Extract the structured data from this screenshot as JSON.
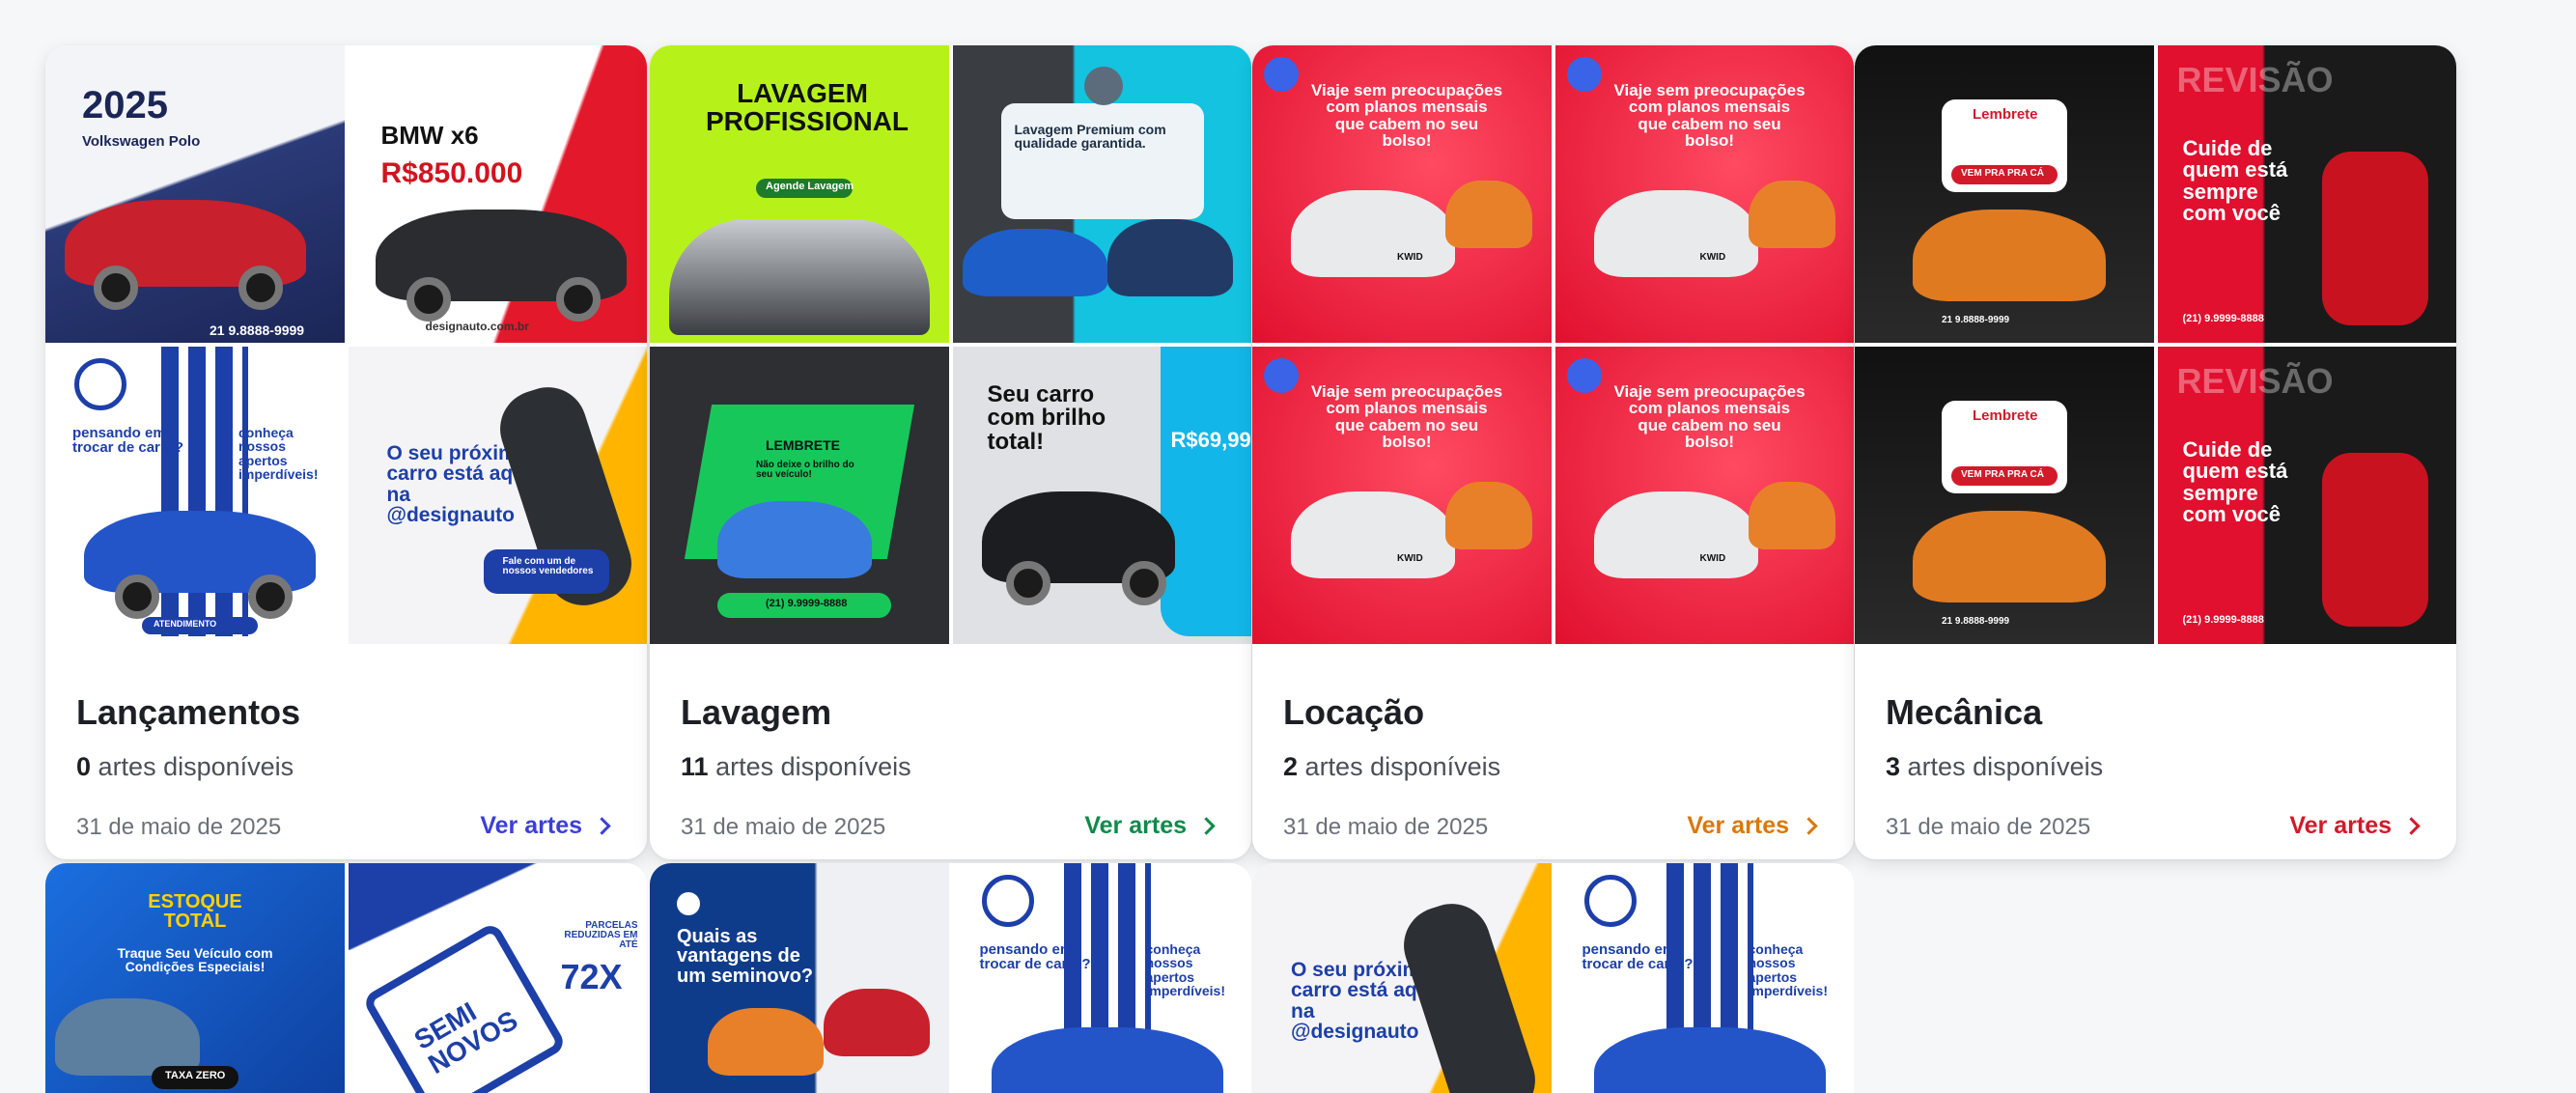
{
  "collections": [
    {
      "title": "Lançamentos",
      "count": "0",
      "count_suffix": "artes disponíveis",
      "date": "31 de maio de 2025",
      "link_label": "Ver artes",
      "accent": "#3b3fd8",
      "thumbs": [
        {
          "title": "2025",
          "sub": "Volkswagen Polo",
          "footer": "21 9.8888-9999"
        },
        {
          "title": "BMW x6",
          "sub": "R$850.000",
          "footer": "designauto.com.br"
        },
        {
          "title": "pensando em trocar de carro?",
          "sub": "conheça nossos apertos imperdíveis!",
          "footer": "ATENDIMENTO"
        },
        {
          "title": "O seu próximo carro está aqui na @designauto",
          "sub": "Fale com um de nossos vendedores",
          "footer": ""
        }
      ]
    },
    {
      "title": "Lavagem",
      "count": "11",
      "count_suffix": "artes disponíveis",
      "date": "31 de maio de 2025",
      "link_label": "Ver artes",
      "accent": "#0f8a4a",
      "thumbs": [
        {
          "title": "LAVAGEM PROFISSIONAL",
          "sub": "Agende Lavagem",
          "footer": ""
        },
        {
          "title": "Lavagem Premium com qualidade garantida.",
          "sub": "",
          "footer": ""
        },
        {
          "title": "LEMBRETE",
          "sub": "Não deixe o brilho do seu veículo!",
          "footer": "(21) 9.9999-8888"
        },
        {
          "title": "Seu carro com brilho total!",
          "sub": "R$69,99",
          "footer": ""
        }
      ]
    },
    {
      "title": "Locação",
      "count": "2",
      "count_suffix": "artes disponíveis",
      "date": "31 de maio de 2025",
      "link_label": "Ver artes",
      "accent": "#d9780b",
      "thumbs": [
        {
          "title": "Viaje sem preocupações com planos mensais que cabem no seu bolso!",
          "sub": "KWID",
          "footer": ""
        },
        {
          "title": "Viaje sem preocupações com planos mensais que cabem no seu bolso!",
          "sub": "KWID",
          "footer": ""
        },
        {
          "title": "Viaje sem preocupações com planos mensais que cabem no seu bolso!",
          "sub": "KWID",
          "footer": ""
        },
        {
          "title": "Viaje sem preocupações com planos mensais que cabem no seu bolso!",
          "sub": "KWID",
          "footer": ""
        }
      ]
    },
    {
      "title": "Mecânica",
      "count": "3",
      "count_suffix": "artes disponíveis",
      "date": "31 de maio de 2025",
      "link_label": "Ver artes",
      "accent": "#d11a2a",
      "thumbs": [
        {
          "title": "Lembrete",
          "sub": "VEM PRA PRA CÁ",
          "footer": "21 9.8888-9999"
        },
        {
          "title": "Cuide de quem está sempre com você",
          "sub": "(21) 9.9999-8888",
          "footer": "REVISÃO"
        },
        {
          "title": "Lembrete",
          "sub": "VEM PRA PRA CÁ",
          "footer": "21 9.8888-9999"
        },
        {
          "title": "Cuide de quem está sempre com você",
          "sub": "(21) 9.9999-8888",
          "footer": "REVISÃO"
        }
      ]
    }
  ],
  "bottom_thumbs": [
    {
      "title": "ESTOQUE TOTAL",
      "sub": "Traque Seu Veículo com Condições Especiais!",
      "footer": "TAXA ZERO"
    },
    {
      "title": "SEMI NOVOS",
      "sub": "PARCELAS REDUZIDAS EM ATÉ",
      "footer": "72X"
    },
    {
      "title": "Quais as vantagens de um seminovo?",
      "sub": "",
      "footer": ""
    },
    {
      "title": "pensando em trocar de carro?",
      "sub": "conheça nossos apertos imperdíveis!",
      "footer": ""
    },
    {
      "title": "O seu próximo carro está aqui na @designauto",
      "sub": "",
      "footer": ""
    },
    {
      "title": "pensando em trocar de carro?",
      "sub": "conheça nossos apertos imperdíveis!",
      "footer": ""
    }
  ]
}
